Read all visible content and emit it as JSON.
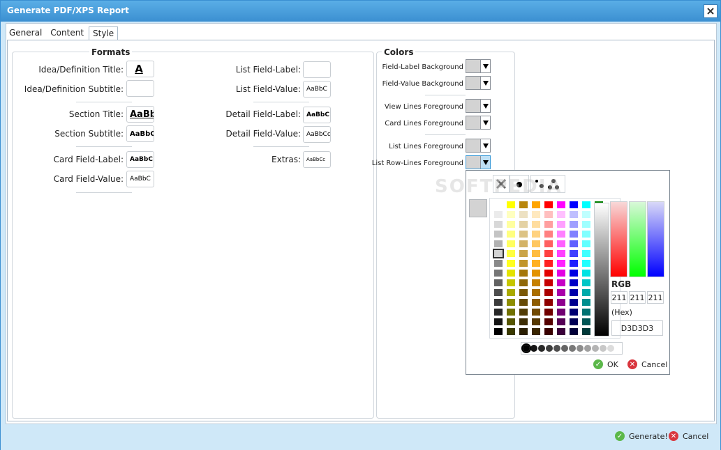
{
  "window": {
    "title": "Generate PDF/XPS Report"
  },
  "tabs": [
    {
      "label": "General",
      "active": false
    },
    {
      "label": "Content",
      "active": false
    },
    {
      "label": "Style",
      "active": true
    }
  ],
  "formats": {
    "title": "Formats",
    "left": [
      {
        "label": "Idea/Definition Title:",
        "sample": "A"
      },
      {
        "label": "Idea/Definition Subtitle:",
        "sample": ""
      },
      {
        "label": "Section Title:",
        "sample": "AaBb"
      },
      {
        "label": "Section Subtitle:",
        "sample": "AaBbC"
      },
      {
        "label": "Card Field-Label:",
        "sample": "AaBbC"
      },
      {
        "label": "Card Field-Value:",
        "sample": "AaBbC"
      }
    ],
    "right": [
      {
        "label": "List Field-Label:",
        "sample": ""
      },
      {
        "label": "List Field-Value:",
        "sample": "AaBbC"
      },
      {
        "label": "Detail Field-Label:",
        "sample": "AaBbC"
      },
      {
        "label": "Detail Field-Value:",
        "sample": "AaBbCc"
      },
      {
        "label": "Extras:",
        "sample": "AaBbCc"
      }
    ]
  },
  "colors": {
    "title": "Colors",
    "items": [
      "Field-Label Background",
      "Field-Value Background",
      "View Lines Foreground",
      "Card Lines Foreground",
      "List Lines Foreground",
      "List Row-Lines Foreground"
    ],
    "swatch_color": "#D3D3D3"
  },
  "picker": {
    "rgb_label": "RGB",
    "r": "211",
    "g": "211",
    "b": "211",
    "hex_label": "(Hex)",
    "hex": "D3D3D3",
    "ok_label": "OK",
    "cancel_label": "Cancel",
    "top_row": [
      "#ffffff",
      "#ffff00",
      "#b8860b",
      "#ffa500",
      "#ff0000",
      "#ff00ff",
      "#0000ff",
      "#00ffff",
      "#008000"
    ],
    "selected_color": "#D3D3D3",
    "watermark": "SOFTPEDIA"
  },
  "footer": {
    "generate_label": "Generate!",
    "cancel_label": "Cancel"
  }
}
